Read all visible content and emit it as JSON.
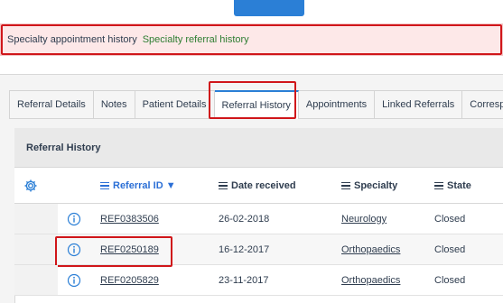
{
  "banner": {
    "label": "Specialty appointment history",
    "link": "Specialty referral history"
  },
  "tabs": [
    {
      "label": "Referral Details",
      "active": false
    },
    {
      "label": "Notes",
      "active": false
    },
    {
      "label": "Patient Details",
      "active": false
    },
    {
      "label": "Referral History",
      "active": true
    },
    {
      "label": "Appointments",
      "active": false
    },
    {
      "label": "Linked Referrals",
      "active": false
    },
    {
      "label": "Correspo",
      "active": false
    }
  ],
  "panel": {
    "title": "Referral History"
  },
  "table": {
    "columns": [
      {
        "label": "Referral ID ▼",
        "sorted": true
      },
      {
        "label": "Date received",
        "sorted": false
      },
      {
        "label": "Specialty",
        "sorted": false
      },
      {
        "label": "State",
        "sorted": false
      }
    ],
    "rows": [
      {
        "id": "REF0383506",
        "date": "26-02-2018",
        "specialty": "Neurology",
        "state": "Closed"
      },
      {
        "id": "REF0250189",
        "date": "16-12-2017",
        "specialty": "Orthopaedics",
        "state": "Closed"
      },
      {
        "id": "REF0205829",
        "date": "23-11-2017",
        "specialty": "Orthopaedics",
        "state": "Closed"
      }
    ]
  },
  "colors": {
    "accent": "#2b7fd6",
    "highlight": "#d0161a",
    "banner_bg": "#fde8e8",
    "banner_link": "#2e7d32"
  }
}
